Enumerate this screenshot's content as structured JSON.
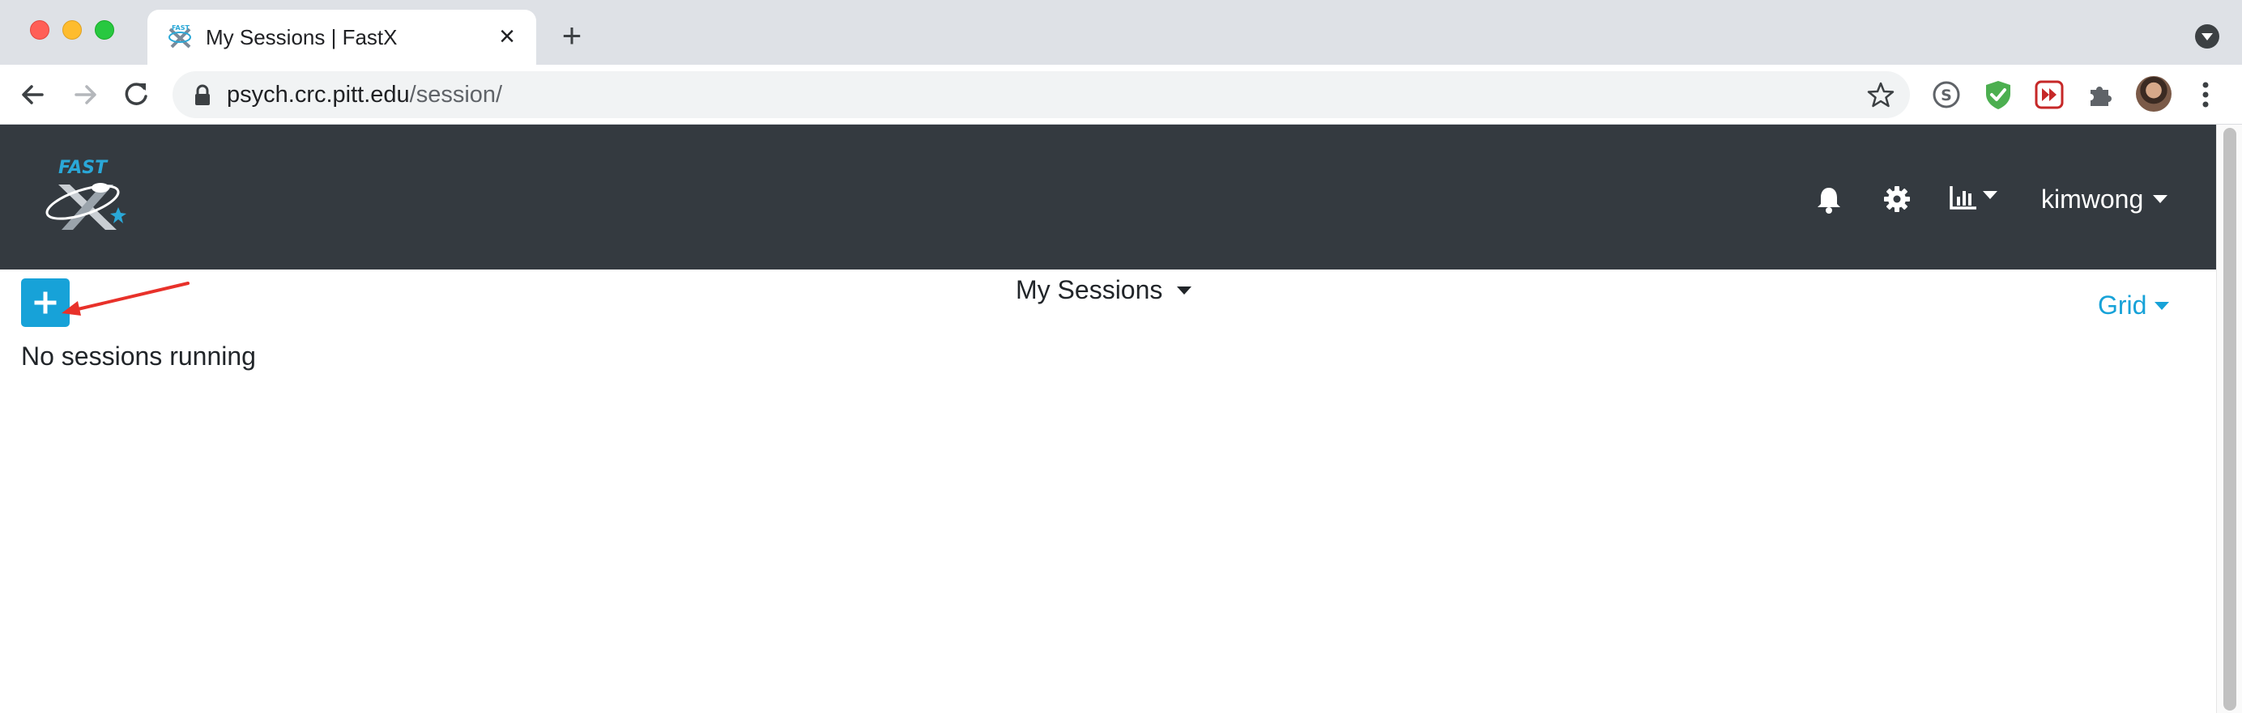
{
  "browser": {
    "tab_title": "My Sessions | FastX",
    "tab_close_glyph": "×",
    "new_tab_glyph": "+",
    "url_host": "psych.crc.pitt.edu",
    "url_path": "/session/",
    "extensions": [
      "skype-icon",
      "shield-check-icon",
      "forward-media-icon",
      "puzzle-extensions-icon"
    ]
  },
  "navbar": {
    "logo_text": "FAST X",
    "notifications_icon": "bell-icon",
    "settings_icon": "gear-icon",
    "stats_icon": "bar-chart-icon",
    "username": "kimwong"
  },
  "main": {
    "add_button_icon": "plus-icon",
    "sessions_menu_label": "My Sessions",
    "view_menu_label": "Grid",
    "empty_message": "No sessions running"
  },
  "colors": {
    "navbar_bg": "#343a40",
    "accent": "#17a2d8",
    "annotation_arrow": "#e8312a"
  }
}
